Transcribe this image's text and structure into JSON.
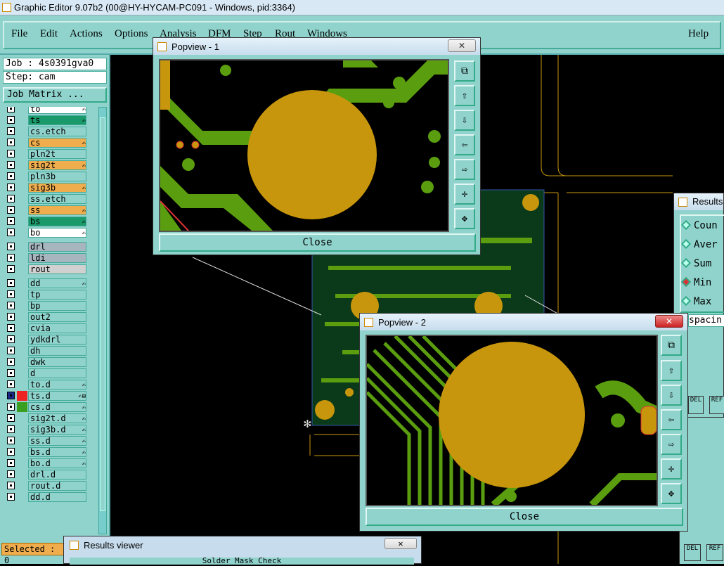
{
  "window": {
    "title": "Graphic Editor 9.07b2 (00@HY-HYCAM-PC091 - Windows, pid:3364)"
  },
  "menu": {
    "items": [
      "File",
      "Edit",
      "Actions",
      "Options",
      "Analysis",
      "DFM",
      "Step",
      "Rout",
      "Windows"
    ],
    "help": "Help"
  },
  "job": {
    "label": "Job : 4s0391gva0",
    "step": "Step: cam",
    "matrix_button": "Job Matrix ..."
  },
  "layers": [
    {
      "name": "to",
      "color": "#ffffff",
      "flag": "✍"
    },
    {
      "name": "ts",
      "color": "#1a9a6a",
      "flag": "✍"
    },
    {
      "name": "cs.etch",
      "color": "#8fd3cc",
      "flag": ""
    },
    {
      "name": "cs",
      "color": "#f0ad4e",
      "flag": "✍"
    },
    {
      "name": "pln2t",
      "color": "#8fd3cc",
      "flag": ""
    },
    {
      "name": "sig2t",
      "color": "#f0ad4e",
      "flag": "✍"
    },
    {
      "name": "pln3b",
      "color": "#8fd3cc",
      "flag": ""
    },
    {
      "name": "sig3b",
      "color": "#f0ad4e",
      "flag": "✍"
    },
    {
      "name": "ss.etch",
      "color": "#8fd3cc",
      "flag": ""
    },
    {
      "name": "ss",
      "color": "#f0ad4e",
      "flag": "✍"
    },
    {
      "name": "bs",
      "color": "#1a9a6a",
      "flag": "✍"
    },
    {
      "name": "bo",
      "color": "#ffffff",
      "flag": "✍"
    },
    {
      "name": "drl",
      "color": "#a7b5bf",
      "flag": ""
    },
    {
      "name": "ldi",
      "color": "#a7b5bf",
      "flag": ""
    },
    {
      "name": "rout",
      "color": "#d0d0d0",
      "flag": ""
    },
    {
      "name": "dd",
      "color": "#8fd3cc",
      "flag": "✍"
    },
    {
      "name": "tp",
      "color": "#8fd3cc",
      "flag": ""
    },
    {
      "name": "bp",
      "color": "#8fd3cc",
      "flag": ""
    },
    {
      "name": "out2",
      "color": "#8fd3cc",
      "flag": ""
    },
    {
      "name": "cvia",
      "color": "#8fd3cc",
      "flag": ""
    },
    {
      "name": "ydkdrl",
      "color": "#8fd3cc",
      "flag": ""
    },
    {
      "name": "dh",
      "color": "#8fd3cc",
      "flag": ""
    },
    {
      "name": "dwk",
      "color": "#8fd3cc",
      "flag": ""
    },
    {
      "name": "d",
      "color": "#8fd3cc",
      "flag": ""
    },
    {
      "name": "to.d",
      "color": "#8fd3cc",
      "flag": "✍"
    },
    {
      "name": "ts.d",
      "color": "#8fd3cc",
      "flag": "✍⊞"
    },
    {
      "name": "cs.d",
      "color": "#8fd3cc",
      "flag": "✍"
    },
    {
      "name": "sig2t.d",
      "color": "#8fd3cc",
      "flag": "✍"
    },
    {
      "name": "sig3b.d",
      "color": "#8fd3cc",
      "flag": "✍"
    },
    {
      "name": "ss.d",
      "color": "#8fd3cc",
      "flag": "✍"
    },
    {
      "name": "bs.d",
      "color": "#8fd3cc",
      "flag": "✍"
    },
    {
      "name": "bo.d",
      "color": "#8fd3cc",
      "flag": "✍"
    },
    {
      "name": "drl.d",
      "color": "#8fd3cc",
      "flag": ""
    },
    {
      "name": "rout.d",
      "color": "#8fd3cc",
      "flag": ""
    },
    {
      "name": "dd.d",
      "color": "#8fd3cc",
      "flag": ""
    }
  ],
  "selected": "Selected : 0",
  "popview1": {
    "title": "Popview - 1",
    "close_label": "Close",
    "x": "✕"
  },
  "popview2": {
    "title": "Popview - 2",
    "close_label": "Close",
    "x": "✕"
  },
  "results": {
    "title": "Results",
    "options": [
      "Coun",
      "Aver",
      "Sum",
      "Min",
      "Max"
    ],
    "selected": "Min",
    "field": "spacin"
  },
  "results_viewer": {
    "title": "Results viewer",
    "x": "✕",
    "subtitle": "Solder Mask Check"
  },
  "buttons": {
    "del": "DEL",
    "ref": "REF"
  },
  "colors": {
    "panel": "#8fd3cc",
    "copper": "#c8960c",
    "trace": "#5a9e10",
    "background": "#000000"
  }
}
